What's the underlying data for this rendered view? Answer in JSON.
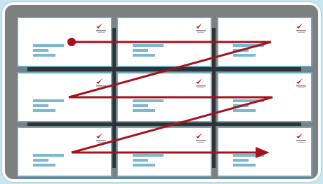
{
  "diagram": {
    "colors": {
      "background": "#c9e6ee",
      "frame_fill": "#7d7f81",
      "frame_border": "#f7fbfc",
      "card_fill": "#ffffff",
      "card_border": "#6aaac0",
      "separator": "#2f3335",
      "text_bar": "#7cb8d0",
      "arrow": "#a5121c",
      "logo": "#b01420"
    },
    "grid": {
      "rows": 3,
      "columns": 3
    },
    "cards": [
      {
        "row": 1,
        "col": 1
      },
      {
        "row": 1,
        "col": 2
      },
      {
        "row": 1,
        "col": 3
      },
      {
        "row": 2,
        "col": 1
      },
      {
        "row": 2,
        "col": 2
      },
      {
        "row": 2,
        "col": 3
      },
      {
        "row": 3,
        "col": 1
      },
      {
        "row": 3,
        "col": 2
      },
      {
        "row": 3,
        "col": 3
      }
    ],
    "card_icons": [
      "brand-logo-icon",
      "address-block-icon"
    ],
    "path": {
      "description_icon": "reading-order-arrow-icon",
      "start_marker": "dot",
      "end_marker": "arrowhead"
    }
  }
}
